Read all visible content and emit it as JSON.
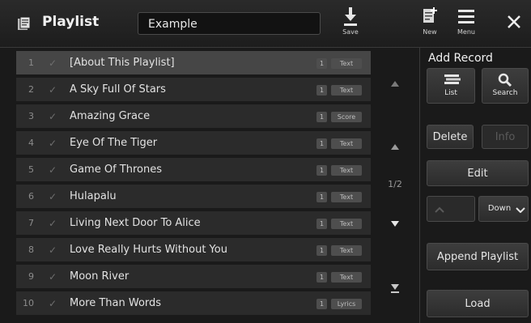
{
  "header": {
    "title": "Playlist",
    "name_value": "Example",
    "save_label": "Save",
    "new_label": "New",
    "menu_label": "Menu"
  },
  "playlist": {
    "page_indicator": "1/2",
    "rows": [
      {
        "num": "1",
        "title": "[About This Playlist]",
        "count": "1",
        "type": "Text"
      },
      {
        "num": "2",
        "title": "A Sky Full Of Stars",
        "count": "1",
        "type": "Text"
      },
      {
        "num": "3",
        "title": "Amazing Grace",
        "count": "1",
        "type": "Score"
      },
      {
        "num": "4",
        "title": "Eye Of The Tiger",
        "count": "1",
        "type": "Text"
      },
      {
        "num": "5",
        "title": "Game Of Thrones",
        "count": "1",
        "type": "Text"
      },
      {
        "num": "6",
        "title": "Hulapalu",
        "count": "1",
        "type": "Text"
      },
      {
        "num": "7",
        "title": "Living Next Door To Alice",
        "count": "1",
        "type": "Text"
      },
      {
        "num": "8",
        "title": "Love Really Hurts Without You",
        "count": "1",
        "type": "Text"
      },
      {
        "num": "9",
        "title": "Moon River",
        "count": "1",
        "type": "Text"
      },
      {
        "num": "10",
        "title": "More Than Words",
        "count": "1",
        "type": "Lyrics"
      }
    ]
  },
  "side_panel": {
    "add_record_title": "Add Record",
    "list_label": "List",
    "search_label": "Search",
    "delete_label": "Delete",
    "info_label": "Info",
    "edit_label": "Edit",
    "down_label": "Down",
    "append_label": "Append Playlist",
    "load_label": "Load"
  }
}
